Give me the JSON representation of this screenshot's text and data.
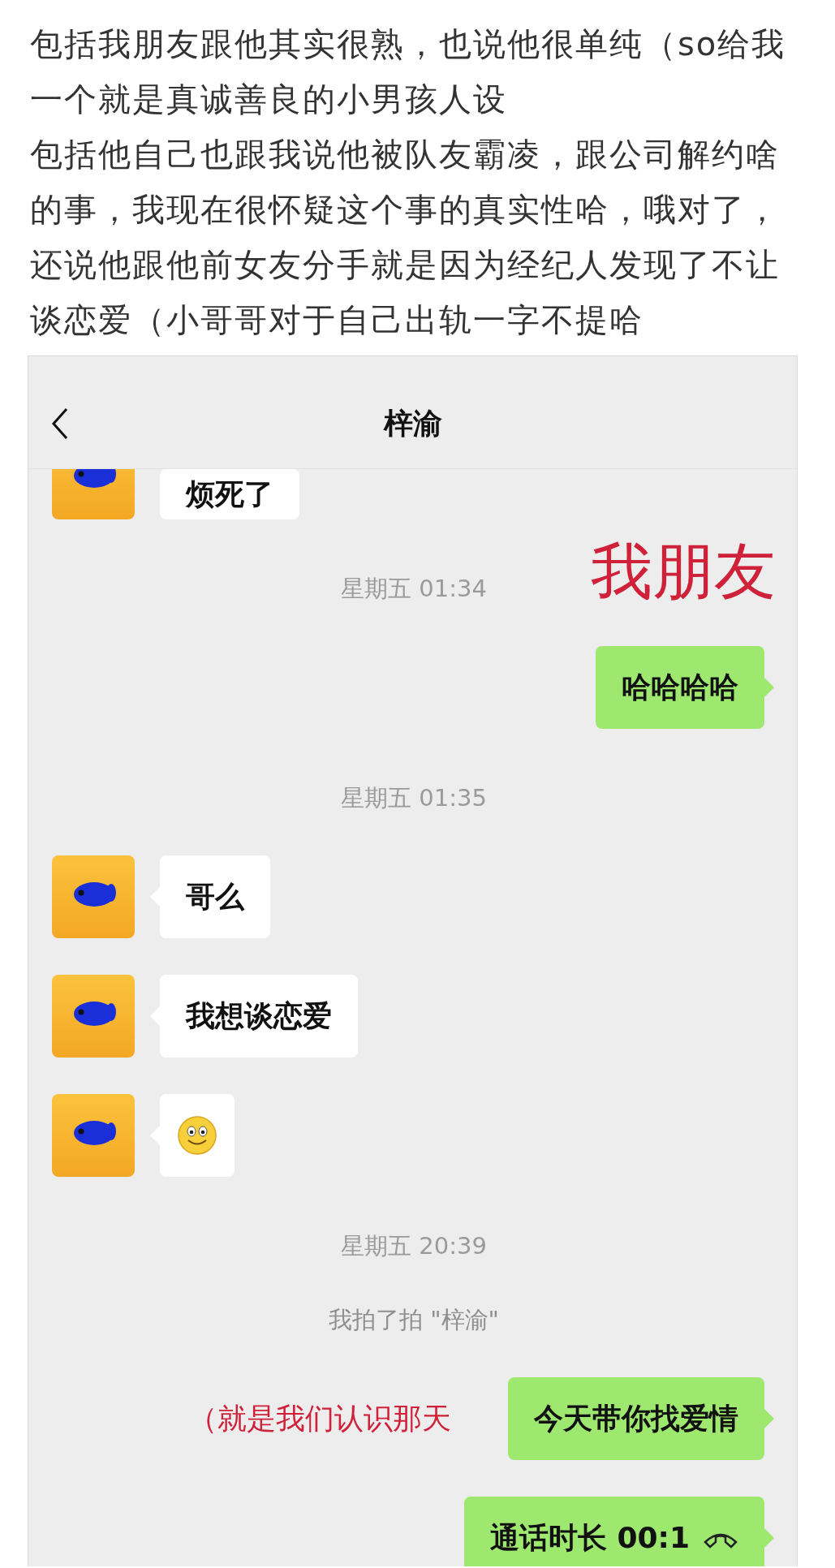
{
  "post": {
    "paragraphs": [
      "包括我朋友跟他其实很熟，也说他很单纯（so给我一个就是真诚善良的小男孩人设",
      "包括他自己也跟我说他被队友霸凌，跟公司解约啥的事，我现在很怀疑这个事的真实性哈，哦对了，还说他跟他前女友分手就是因为经纪人发现了不让谈恋爱（小哥哥对于自己出轨一字不提哈"
    ]
  },
  "chat": {
    "title": "梓渝",
    "messages": [
      {
        "kind": "received",
        "text": "烦死了"
      },
      {
        "kind": "timestamp",
        "text": "星期五 01:34",
        "note": "我朋友"
      },
      {
        "kind": "sent",
        "text": "哈哈哈哈"
      },
      {
        "kind": "timestamp",
        "text": "星期五 01:35"
      },
      {
        "kind": "received",
        "text": "哥么"
      },
      {
        "kind": "received",
        "text": "我想谈恋爱"
      },
      {
        "kind": "emoji"
      },
      {
        "kind": "timestamp",
        "text": "星期五 20:39"
      },
      {
        "kind": "system",
        "text": "我拍了拍 \"梓渝\""
      },
      {
        "kind": "sent",
        "text": "今天带你找爱情",
        "note": "（就是我们认识那天"
      },
      {
        "kind": "sent",
        "text": "通话时长 00:1",
        "call": true
      }
    ]
  }
}
